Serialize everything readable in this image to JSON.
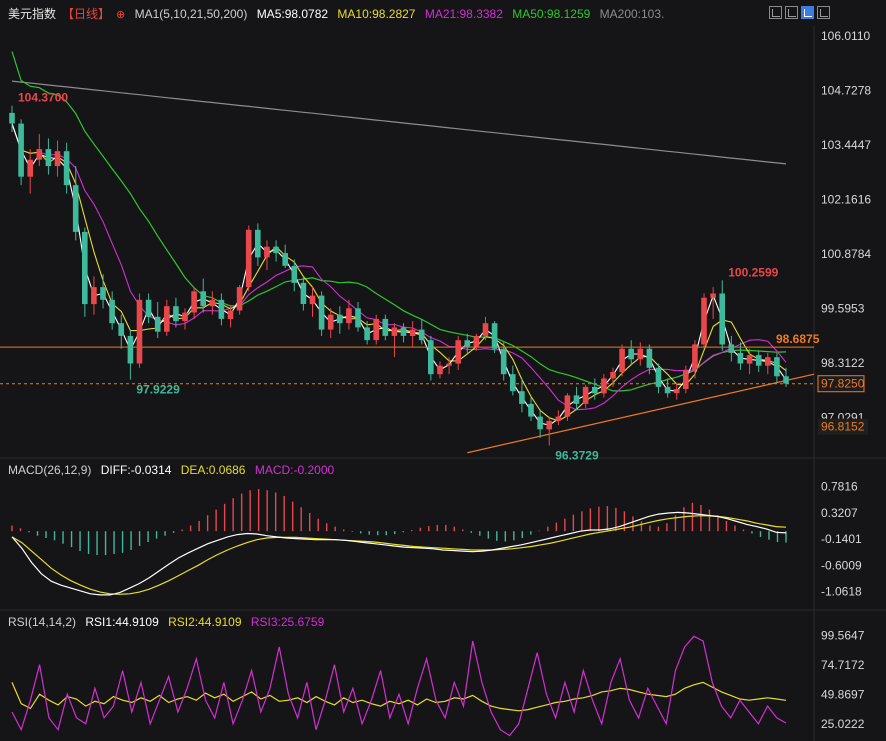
{
  "header": {
    "title": "美元指数",
    "period": "【日线】",
    "ma_spec": "MA1(5,10,21,50,200)",
    "ma5": "MA5:98.0782",
    "ma10": "MA10:98.2827",
    "ma21": "MA21:98.3382",
    "ma50": "MA50:98.1259",
    "ma200": "MA200:103."
  },
  "macd_header": {
    "spec": "MACD(26,12,9)",
    "diff": "DIFF:-0.0314",
    "dea": "DEA:0.0686",
    "macd": "MACD:-0.2000"
  },
  "rsi_header": {
    "spec": "RSI(14,14,2)",
    "rsi1": "RSI1:44.9109",
    "rsi2": "RSI2:44.9109",
    "rsi3": "RSI3:25.6759"
  },
  "colors": {
    "up": "#e8474c",
    "down": "#3fb99b",
    "ma5": "#ffffff",
    "ma10": "#e8dd2a",
    "ma21": "#d32fd3",
    "ma50": "#2fc72f",
    "ma200": "#8c8c8c",
    "trend": "#f07a1e",
    "axis_text": "#d8d8d8"
  },
  "chart_data": [
    {
      "type": "candlestick",
      "name": "main",
      "y_ticks": [
        106.011,
        104.7278,
        103.4447,
        102.1616,
        100.8784,
        99.5953,
        98.3122,
        97.0291
      ],
      "y_tick_labels": [
        "106.0110",
        "104.7278",
        "103.4447",
        "102.1616",
        "100.8784",
        "99.5953",
        "98.3122",
        "97.0291"
      ],
      "ylim": [
        96.5,
        106.2
      ],
      "current_price": "97.8250",
      "level_price": "96.8152",
      "resistance_price": "98.6875",
      "annotations": {
        "high": "104.3700",
        "low1": "97.9229",
        "low2": "96.3729",
        "high2": "100.2599"
      },
      "ohlc": [
        [
          104.2,
          104.37,
          103.75,
          103.95
        ],
        [
          103.95,
          104.05,
          102.5,
          102.7
        ],
        [
          102.7,
          103.35,
          102.3,
          103.1
        ],
        [
          103.1,
          103.7,
          102.95,
          103.35
        ],
        [
          103.35,
          103.6,
          102.75,
          102.95
        ],
        [
          102.95,
          103.55,
          102.7,
          103.3
        ],
        [
          103.3,
          103.5,
          102.3,
          102.5
        ],
        [
          102.5,
          102.95,
          101.2,
          101.4
        ],
        [
          101.4,
          101.5,
          99.4,
          99.7
        ],
        [
          99.7,
          100.35,
          99.45,
          100.1
        ],
        [
          100.1,
          100.4,
          99.6,
          99.8
        ],
        [
          99.8,
          100.0,
          99.1,
          99.25
        ],
        [
          99.25,
          99.45,
          98.65,
          98.95
        ],
        [
          98.95,
          99.1,
          97.92,
          98.3
        ],
        [
          98.3,
          99.95,
          98.2,
          99.8
        ],
        [
          99.8,
          99.95,
          99.25,
          99.4
        ],
        [
          99.4,
          99.75,
          98.9,
          99.05
        ],
        [
          99.05,
          99.8,
          98.95,
          99.65
        ],
        [
          99.65,
          99.85,
          99.15,
          99.3
        ],
        [
          99.3,
          99.6,
          99.1,
          99.5
        ],
        [
          99.5,
          100.1,
          99.35,
          100.0
        ],
        [
          100.0,
          100.3,
          99.5,
          99.65
        ],
        [
          99.65,
          100.0,
          99.45,
          99.8
        ],
        [
          99.8,
          99.95,
          99.2,
          99.35
        ],
        [
          99.35,
          99.65,
          99.15,
          99.55
        ],
        [
          99.55,
          100.15,
          99.45,
          100.1
        ],
        [
          100.1,
          101.55,
          100.0,
          101.45
        ],
        [
          101.45,
          101.6,
          100.6,
          100.8
        ],
        [
          100.8,
          101.2,
          100.5,
          101.05
        ],
        [
          101.05,
          101.2,
          100.7,
          100.9
        ],
        [
          100.9,
          101.1,
          100.55,
          100.6
        ],
        [
          100.6,
          100.75,
          100.0,
          100.2
        ],
        [
          100.2,
          100.35,
          99.55,
          99.7
        ],
        [
          99.7,
          100.1,
          99.4,
          99.9
        ],
        [
          99.9,
          100.0,
          98.95,
          99.1
        ],
        [
          99.1,
          99.6,
          98.9,
          99.45
        ],
        [
          99.45,
          99.65,
          99.0,
          99.25
        ],
        [
          99.25,
          99.8,
          99.1,
          99.6
        ],
        [
          99.6,
          99.75,
          99.05,
          99.15
        ],
        [
          99.15,
          99.3,
          98.75,
          98.85
        ],
        [
          98.85,
          99.45,
          98.75,
          99.35
        ],
        [
          99.35,
          99.45,
          98.85,
          98.95
        ],
        [
          98.95,
          99.25,
          98.45,
          99.15
        ],
        [
          99.15,
          99.25,
          98.8,
          98.95
        ],
        [
          98.95,
          99.3,
          98.7,
          99.1
        ],
        [
          99.1,
          99.35,
          98.75,
          98.85
        ],
        [
          98.85,
          98.95,
          97.9,
          98.05
        ],
        [
          98.05,
          98.35,
          97.95,
          98.25
        ],
        [
          98.25,
          98.45,
          98.05,
          98.3
        ],
        [
          98.3,
          98.95,
          98.15,
          98.85
        ],
        [
          98.85,
          99.0,
          98.55,
          98.7
        ],
        [
          98.7,
          99.0,
          98.6,
          98.95
        ],
        [
          98.95,
          99.4,
          98.85,
          99.25
        ],
        [
          99.25,
          99.3,
          98.55,
          98.65
        ],
        [
          98.65,
          98.8,
          97.9,
          98.05
        ],
        [
          98.05,
          98.25,
          97.55,
          97.65
        ],
        [
          97.65,
          97.95,
          97.15,
          97.35
        ],
        [
          97.35,
          97.5,
          96.95,
          97.05
        ],
        [
          97.05,
          97.2,
          96.55,
          96.75
        ],
        [
          96.75,
          97.05,
          96.37,
          96.95
        ],
        [
          96.95,
          97.2,
          96.85,
          97.05
        ],
        [
          97.05,
          97.6,
          96.95,
          97.55
        ],
        [
          97.55,
          97.75,
          97.2,
          97.35
        ],
        [
          97.35,
          97.8,
          97.25,
          97.75
        ],
        [
          97.75,
          97.95,
          97.45,
          97.6
        ],
        [
          97.6,
          98.05,
          97.5,
          97.95
        ],
        [
          97.95,
          98.2,
          97.75,
          98.1
        ],
        [
          98.1,
          98.75,
          98.0,
          98.65
        ],
        [
          98.65,
          98.85,
          98.25,
          98.4
        ],
        [
          98.4,
          98.8,
          98.25,
          98.65
        ],
        [
          98.65,
          98.75,
          98.05,
          98.2
        ],
        [
          98.2,
          98.3,
          97.6,
          97.75
        ],
        [
          97.75,
          97.95,
          97.5,
          97.6
        ],
        [
          97.6,
          97.85,
          97.45,
          97.7
        ],
        [
          97.7,
          98.25,
          97.6,
          98.15
        ],
        [
          98.15,
          98.85,
          97.95,
          98.75
        ],
        [
          98.75,
          99.95,
          98.65,
          99.85
        ],
        [
          99.85,
          100.1,
          99.35,
          99.95
        ],
        [
          99.95,
          100.26,
          98.6,
          98.75
        ],
        [
          98.75,
          98.95,
          98.35,
          98.55
        ],
        [
          98.55,
          98.8,
          98.15,
          98.3
        ],
        [
          98.3,
          98.65,
          98.05,
          98.5
        ],
        [
          98.5,
          98.6,
          98.1,
          98.25
        ],
        [
          98.25,
          98.55,
          98.05,
          98.45
        ],
        [
          98.45,
          98.55,
          97.85,
          98.0
        ],
        [
          98.0,
          98.2,
          97.75,
          97.83
        ]
      ]
    },
    {
      "type": "bar",
      "name": "MACD",
      "y_tick_labels": [
        "0.7816",
        "0.3207",
        "-0.1401",
        "-0.6009",
        "-1.0618"
      ],
      "y_ticks": [
        0.7816,
        0.3207,
        -0.1401,
        -0.6009,
        -1.0618
      ],
      "ylim": [
        -1.28,
        0.97
      ],
      "histogram": [
        0.1,
        0.05,
        -0.02,
        -0.08,
        -0.12,
        -0.16,
        -0.22,
        -0.28,
        -0.35,
        -0.4,
        -0.42,
        -0.42,
        -0.4,
        -0.38,
        -0.33,
        -0.26,
        -0.19,
        -0.13,
        -0.08,
        -0.03,
        0.03,
        0.1,
        0.18,
        0.28,
        0.38,
        0.48,
        0.58,
        0.66,
        0.72,
        0.74,
        0.72,
        0.68,
        0.62,
        0.52,
        0.42,
        0.32,
        0.22,
        0.14,
        0.08,
        0.03,
        -0.01,
        -0.04,
        -0.06,
        -0.07,
        -0.07,
        -0.05,
        -0.02,
        0.02,
        0.06,
        0.09,
        0.11,
        0.11,
        0.08,
        0.03,
        -0.03,
        -0.08,
        -0.13,
        -0.17,
        -0.18,
        -0.16,
        -0.12,
        -0.06,
        0.01,
        0.08,
        0.15,
        0.22,
        0.29,
        0.35,
        0.4,
        0.43,
        0.44,
        0.41,
        0.35,
        0.26,
        0.17,
        0.1,
        0.08,
        0.14,
        0.28,
        0.42,
        0.5,
        0.46,
        0.38,
        0.28,
        0.18,
        0.1,
        0.03,
        -0.04,
        -0.1,
        -0.15,
        -0.19,
        -0.2
      ],
      "diff": [
        -0.1,
        -0.3,
        -0.55,
        -0.75,
        -0.88,
        -0.95,
        -1.0,
        -1.05,
        -1.1,
        -1.12,
        -1.12,
        -1.08,
        -1.0,
        -0.92,
        -0.82,
        -0.7,
        -0.58,
        -0.47,
        -0.38,
        -0.3,
        -0.22,
        -0.16,
        -0.1,
        -0.06,
        -0.04,
        -0.05,
        -0.08,
        -0.1,
        -0.12,
        -0.13,
        -0.14,
        -0.15,
        -0.15,
        -0.15,
        -0.16,
        -0.18,
        -0.2,
        -0.22,
        -0.24,
        -0.26,
        -0.28,
        -0.29,
        -0.3,
        -0.31,
        -0.33,
        -0.34,
        -0.35,
        -0.36,
        -0.35,
        -0.33,
        -0.3,
        -0.27,
        -0.24,
        -0.2,
        -0.16,
        -0.12,
        -0.08,
        -0.04,
        0.0,
        0.02,
        0.02,
        0.04,
        0.08,
        0.14,
        0.2,
        0.26,
        0.3,
        0.32,
        0.33,
        0.32,
        0.3,
        0.28,
        0.26,
        0.22,
        0.17,
        0.12,
        0.08,
        0.04,
        -0.02,
        -0.03
      ],
      "dea": [
        -0.1,
        -0.2,
        -0.35,
        -0.5,
        -0.65,
        -0.77,
        -0.87,
        -0.95,
        -1.02,
        -1.07,
        -1.1,
        -1.11,
        -1.1,
        -1.07,
        -1.02,
        -0.95,
        -0.87,
        -0.78,
        -0.69,
        -0.6,
        -0.5,
        -0.41,
        -0.33,
        -0.26,
        -0.2,
        -0.15,
        -0.12,
        -0.11,
        -0.11,
        -0.11,
        -0.12,
        -0.13,
        -0.14,
        -0.15,
        -0.16,
        -0.17,
        -0.18,
        -0.19,
        -0.21,
        -0.23,
        -0.25,
        -0.27,
        -0.28,
        -0.29,
        -0.3,
        -0.31,
        -0.32,
        -0.33,
        -0.33,
        -0.33,
        -0.32,
        -0.31,
        -0.29,
        -0.27,
        -0.24,
        -0.21,
        -0.17,
        -0.13,
        -0.09,
        -0.05,
        -0.02,
        0.01,
        0.04,
        0.07,
        0.11,
        0.15,
        0.19,
        0.22,
        0.24,
        0.26,
        0.27,
        0.27,
        0.26,
        0.24,
        0.21,
        0.18,
        0.14,
        0.11,
        0.08,
        0.07
      ]
    },
    {
      "type": "line",
      "name": "RSI",
      "y_tick_labels": [
        "99.5647",
        "74.7172",
        "49.8697",
        "25.0222"
      ],
      "y_ticks": [
        99.5647,
        74.7172,
        49.8697,
        25.0222
      ],
      "ylim": [
        13,
        106
      ],
      "series": [
        {
          "name": "RSI1",
          "values": [
            60,
            42,
            38,
            50,
            45,
            41,
            48,
            46,
            40,
            44,
            42,
            48,
            45,
            43,
            47,
            44,
            49,
            43,
            46,
            48,
            45,
            51,
            47,
            50,
            44,
            48,
            52,
            46,
            49,
            44,
            45,
            47,
            43,
            48,
            44,
            41,
            47,
            43,
            45,
            42,
            40,
            44,
            42,
            45,
            41,
            46,
            43,
            44,
            47,
            46,
            49,
            44,
            40,
            38,
            37,
            36,
            37,
            39,
            41,
            43,
            44,
            46,
            47,
            49,
            52,
            53,
            55,
            54,
            52,
            50,
            49,
            48,
            50,
            55,
            58,
            60,
            56,
            52,
            49,
            46,
            45,
            46,
            47,
            46,
            44.9
          ]
        },
        {
          "name": "RSI3",
          "values": [
            35,
            20,
            45,
            75,
            30,
            20,
            50,
            30,
            25,
            55,
            30,
            40,
            70,
            35,
            60,
            25,
            45,
            65,
            35,
            55,
            80,
            45,
            30,
            60,
            25,
            45,
            70,
            35,
            55,
            90,
            50,
            30,
            60,
            20,
            45,
            75,
            35,
            55,
            25,
            45,
            70,
            30,
            50,
            25,
            55,
            80,
            45,
            30,
            60,
            40,
            95,
            60,
            35,
            20,
            15,
            25,
            55,
            85,
            50,
            30,
            60,
            35,
            70,
            45,
            25,
            60,
            80,
            45,
            30,
            55,
            40,
            25,
            70,
            90,
            99,
            95,
            60,
            40,
            30,
            45,
            35,
            25,
            40,
            30,
            25.7
          ]
        }
      ]
    }
  ]
}
